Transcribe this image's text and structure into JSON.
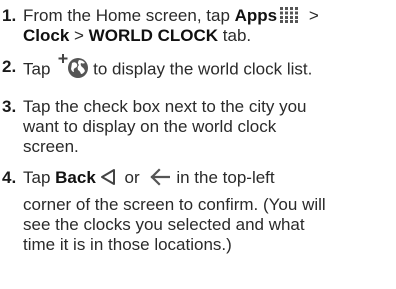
{
  "steps": [
    {
      "number": "1.",
      "line1_pre": "From the Home screen, tap ",
      "line1_bold": "Apps",
      "line1_post": " >",
      "line2_bold1": "Clock",
      "line2_mid": " > ",
      "line2_bold2": "WORLD CLOCK",
      "line2_post": " tab.",
      "icon": "apps-grid-icon"
    },
    {
      "number": "2.",
      "pre": "Tap ",
      "post": "to display the world clock list.",
      "icon": "add-city-globe-icon"
    },
    {
      "number": "3.",
      "lines": [
        "Tap the check box next to the city you",
        "want to display on the world clock",
        "screen."
      ]
    },
    {
      "number": "4.",
      "pre": "Tap ",
      "bold": "Back",
      "mid": " or ",
      "post": "in the top-left",
      "lines": [
        "corner of the screen to confirm. (You will",
        "see the clocks you selected and what",
        "time it is in those locations.)"
      ],
      "icons": [
        "back-triangle-icon",
        "back-arrow-icon"
      ]
    }
  ],
  "colors": {
    "text": "#2a2a2a",
    "icon": "#555555"
  }
}
